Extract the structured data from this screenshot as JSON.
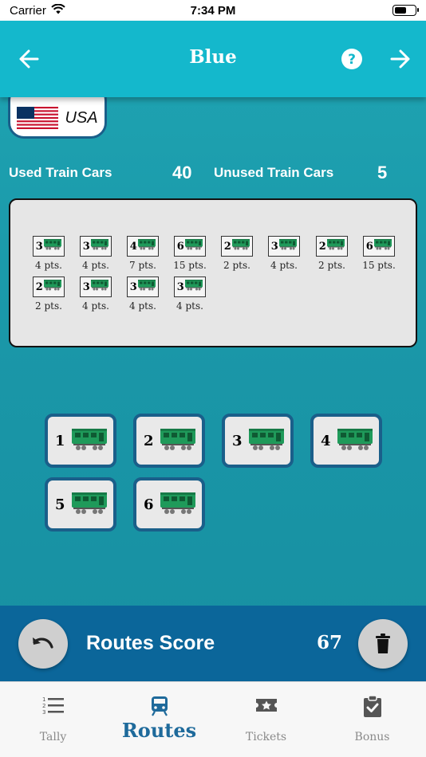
{
  "status_bar": {
    "carrier": "Carrier",
    "time": "7:34 PM"
  },
  "nav": {
    "title": "Blue",
    "back_icon": "arrow-left-icon",
    "help_icon": "question-circle-icon",
    "next_icon": "arrow-right-icon"
  },
  "country": {
    "name": "USA",
    "flag_icon": "us-flag-icon"
  },
  "stats": {
    "used_label": "Used Train Cars",
    "used_value": "40",
    "unused_label": "Unused Train Cars",
    "unused_value": "5"
  },
  "routes": [
    {
      "length": "3",
      "points": "4 pts."
    },
    {
      "length": "3",
      "points": "4 pts."
    },
    {
      "length": "4",
      "points": "7 pts."
    },
    {
      "length": "6",
      "points": "15 pts."
    },
    {
      "length": "2",
      "points": "2 pts."
    },
    {
      "length": "3",
      "points": "4 pts."
    },
    {
      "length": "2",
      "points": "2 pts."
    },
    {
      "length": "6",
      "points": "15 pts."
    },
    {
      "length": "2",
      "points": "2 pts."
    },
    {
      "length": "3",
      "points": "4 pts."
    },
    {
      "length": "3",
      "points": "4 pts."
    },
    {
      "length": "3",
      "points": "4 pts."
    }
  ],
  "length_buttons": [
    "1",
    "2",
    "3",
    "4",
    "5",
    "6"
  ],
  "score": {
    "label": "Routes Score",
    "value": "67",
    "undo_icon": "undo-icon",
    "delete_icon": "trash-icon"
  },
  "tabs": [
    {
      "label": "Tally",
      "icon": "list-numbered-icon",
      "active": false
    },
    {
      "label": "Routes",
      "icon": "train-icon",
      "active": true
    },
    {
      "label": "Tickets",
      "icon": "ticket-star-icon",
      "active": false
    },
    {
      "label": "Bonus",
      "icon": "clipboard-check-icon",
      "active": false
    }
  ],
  "colors": {
    "nav": "#14b8cc",
    "accent": "#1a5f8a",
    "train": "#1f9a5a",
    "score_bar": "#0b669a"
  }
}
